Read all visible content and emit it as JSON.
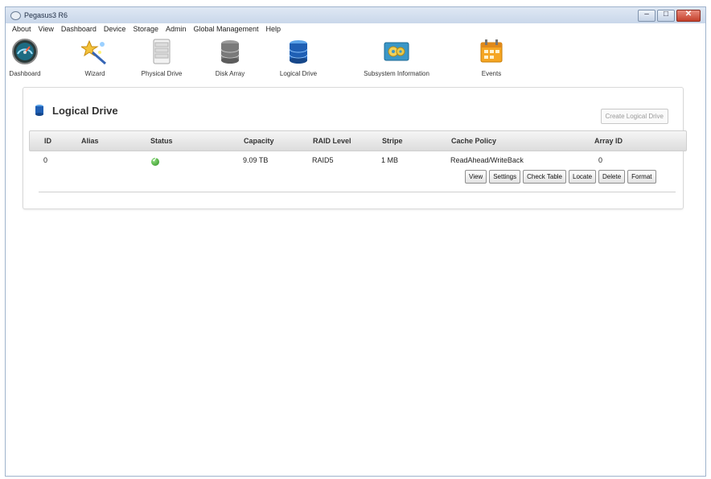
{
  "window": {
    "title": "Pegasus3 R6",
    "controls": {
      "minimize": "–",
      "maximize": "□",
      "close": "✕"
    }
  },
  "menu": [
    "About",
    "View",
    "Dashboard",
    "Device",
    "Storage",
    "Admin",
    "Global Management",
    "Help"
  ],
  "toolbar": [
    {
      "label": "Dashboard",
      "icon": "dashboard-gauge-icon"
    },
    {
      "label": "Wizard",
      "icon": "wizard-icon"
    },
    {
      "label": "Physical Drive",
      "icon": "physical-drive-icon"
    },
    {
      "label": "Disk Array",
      "icon": "disk-array-icon"
    },
    {
      "label": "Logical Drive",
      "icon": "logical-drive-icon"
    },
    {
      "label": "Subsystem Information",
      "icon": "subsystem-information-icon"
    },
    {
      "label": "Events",
      "icon": "events-calendar-icon"
    }
  ],
  "page": {
    "title": "Logical Drive",
    "create_button": "Create Logical Drive"
  },
  "table": {
    "columns": [
      "ID",
      "Alias",
      "Status",
      "Capacity",
      "RAID Level",
      "Stripe",
      "Cache Policy",
      "Array ID"
    ],
    "rows": [
      {
        "id": "0",
        "alias": "",
        "status": "ok",
        "capacity": "9.09 TB",
        "raid_level": "RAID5",
        "stripe": "1 MB",
        "cache_policy": "ReadAhead/WriteBack",
        "array_id": "0",
        "actions": [
          "View",
          "Settings",
          "Check Table",
          "Locate",
          "Delete",
          "Format"
        ]
      }
    ]
  },
  "colors": {
    "title_bar": "#c9d7ea",
    "close_button": "#c4402b",
    "status_ok": "#2f8f22"
  }
}
